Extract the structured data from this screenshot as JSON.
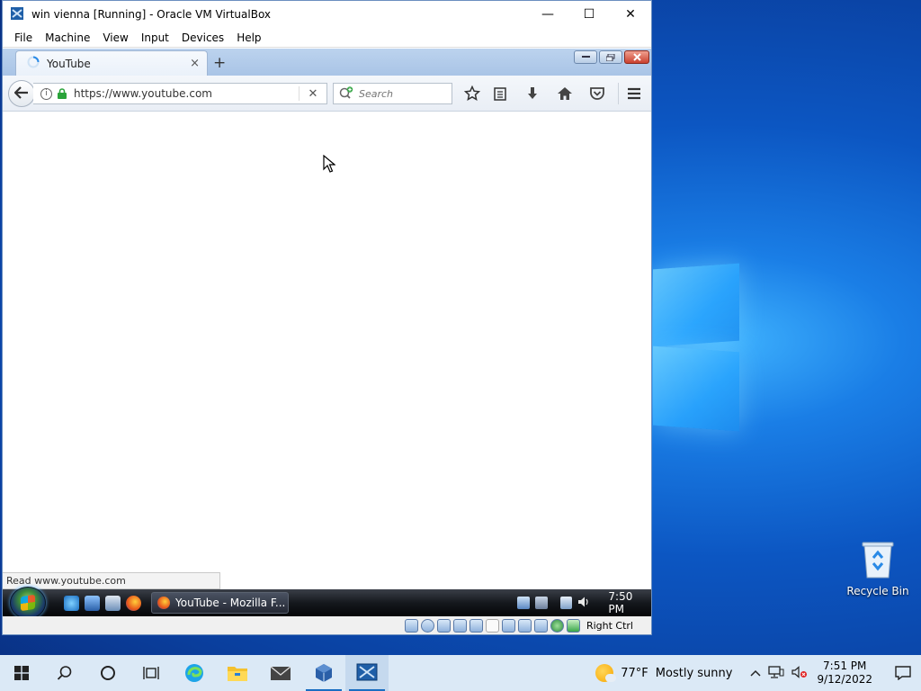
{
  "desktop": {
    "recycle_bin_label": "Recycle Bin"
  },
  "vbox": {
    "title": "win vienna [Running] - Oracle VM VirtualBox",
    "controls": {
      "minimize": "—",
      "maximize": "☐",
      "close": "✕"
    },
    "menu": [
      "File",
      "Machine",
      "View",
      "Input",
      "Devices",
      "Help"
    ],
    "host_key": "Right Ctrl"
  },
  "firefox": {
    "tab_title": "YouTube",
    "tab_close": "×",
    "new_tab": "+",
    "url": "https://www.youtube.com",
    "url_clear": "✕",
    "search_placeholder": "Search",
    "status_text": "Read www.youtube.com"
  },
  "vista": {
    "task_label": "YouTube - Mozilla F...",
    "clock": "7:50 PM"
  },
  "win10_taskbar": {
    "weather_temp": "77°F",
    "weather_desc": "Mostly sunny",
    "time": "7:51 PM",
    "date": "9/12/2022"
  },
  "colors": {
    "accent": "#1a6ec2",
    "desktop_blue": "#0c56c2",
    "firefox_secure": "#2aa33a"
  }
}
